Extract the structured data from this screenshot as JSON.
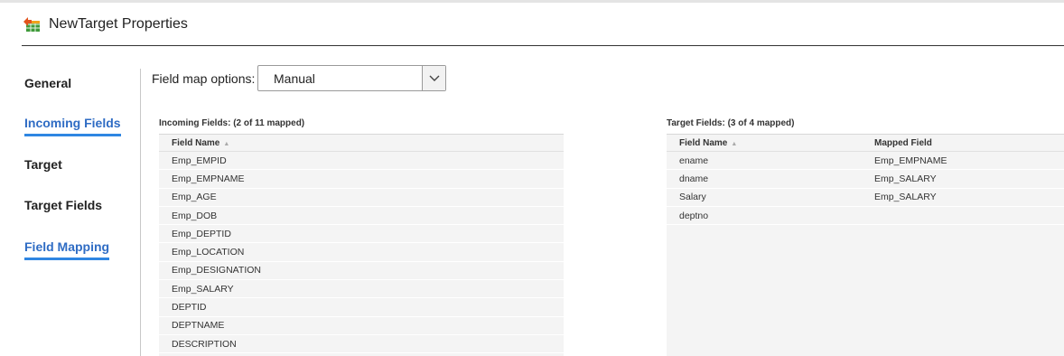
{
  "window": {
    "title": "NewTarget Properties",
    "icon": "target-table-icon"
  },
  "sidebar": {
    "items": [
      {
        "label": "General",
        "linked": false
      },
      {
        "label": "Incoming Fields",
        "linked": true
      },
      {
        "label": "Target",
        "linked": false
      },
      {
        "label": "Target Fields",
        "linked": false
      },
      {
        "label": "Field Mapping",
        "linked": true
      }
    ]
  },
  "field_map": {
    "label": "Field map options:",
    "value": "Manual"
  },
  "incoming": {
    "title": "Incoming Fields: (2 of 11 mapped)",
    "header": "Field Name",
    "rows": [
      "Emp_EMPID",
      "Emp_EMPNAME",
      "Emp_AGE",
      "Emp_DOB",
      "Emp_DEPTID",
      "Emp_LOCATION",
      "Emp_DESIGNATION",
      "Emp_SALARY",
      "DEPTID",
      "DEPTNAME",
      "DESCRIPTION"
    ]
  },
  "target": {
    "title": "Target Fields: (3 of 4 mapped)",
    "headers": {
      "field": "Field Name",
      "mapped": "Mapped Field"
    },
    "rows": [
      {
        "field": "ename",
        "mapped": "Emp_EMPNAME"
      },
      {
        "field": "dname",
        "mapped": "Emp_SALARY"
      },
      {
        "field": "Salary",
        "mapped": "Emp_SALARY"
      },
      {
        "field": "deptno",
        "mapped": ""
      }
    ]
  },
  "colors": {
    "accent": "#2f86e2",
    "link_text": "#2f6cc4",
    "grid_bg": "#f4f4f4"
  }
}
